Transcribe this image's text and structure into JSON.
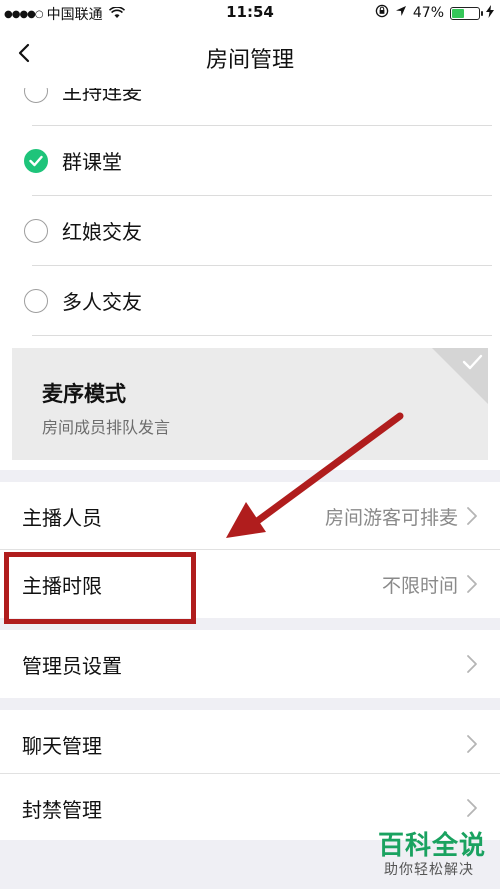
{
  "status_bar": {
    "signal_dots": "●●●●○",
    "carrier": "中国联通",
    "wifi_icon": "wifi-icon",
    "time": "11:54",
    "battery_percent": "47%",
    "battery_level": 0.47,
    "battery_color": "#35c759"
  },
  "nav": {
    "back_icon": "chevron-left-icon",
    "title": "房间管理"
  },
  "modes": {
    "items": [
      {
        "label": "主持连麦",
        "selected": false
      },
      {
        "label": "群课堂",
        "selected": true
      },
      {
        "label": "红娘交友",
        "selected": false
      },
      {
        "label": "多人交友",
        "selected": false
      }
    ],
    "accent_color": "#1ec47a"
  },
  "mode_card": {
    "title": "麦序模式",
    "description": "房间成员排队发言"
  },
  "settings": {
    "anchor_members": {
      "label": "主播人员",
      "value": "房间游客可排麦"
    },
    "anchor_time_limit": {
      "label": "主播时限",
      "value": "不限时间"
    },
    "admin_settings": {
      "label": "管理员设置"
    },
    "chat_management": {
      "label": "聊天管理"
    },
    "ban_management": {
      "label": "封禁管理"
    }
  },
  "annotation": {
    "color": "#b01d1d"
  },
  "watermark": {
    "title": "百科全说",
    "subtitle": "助你轻松解决"
  }
}
